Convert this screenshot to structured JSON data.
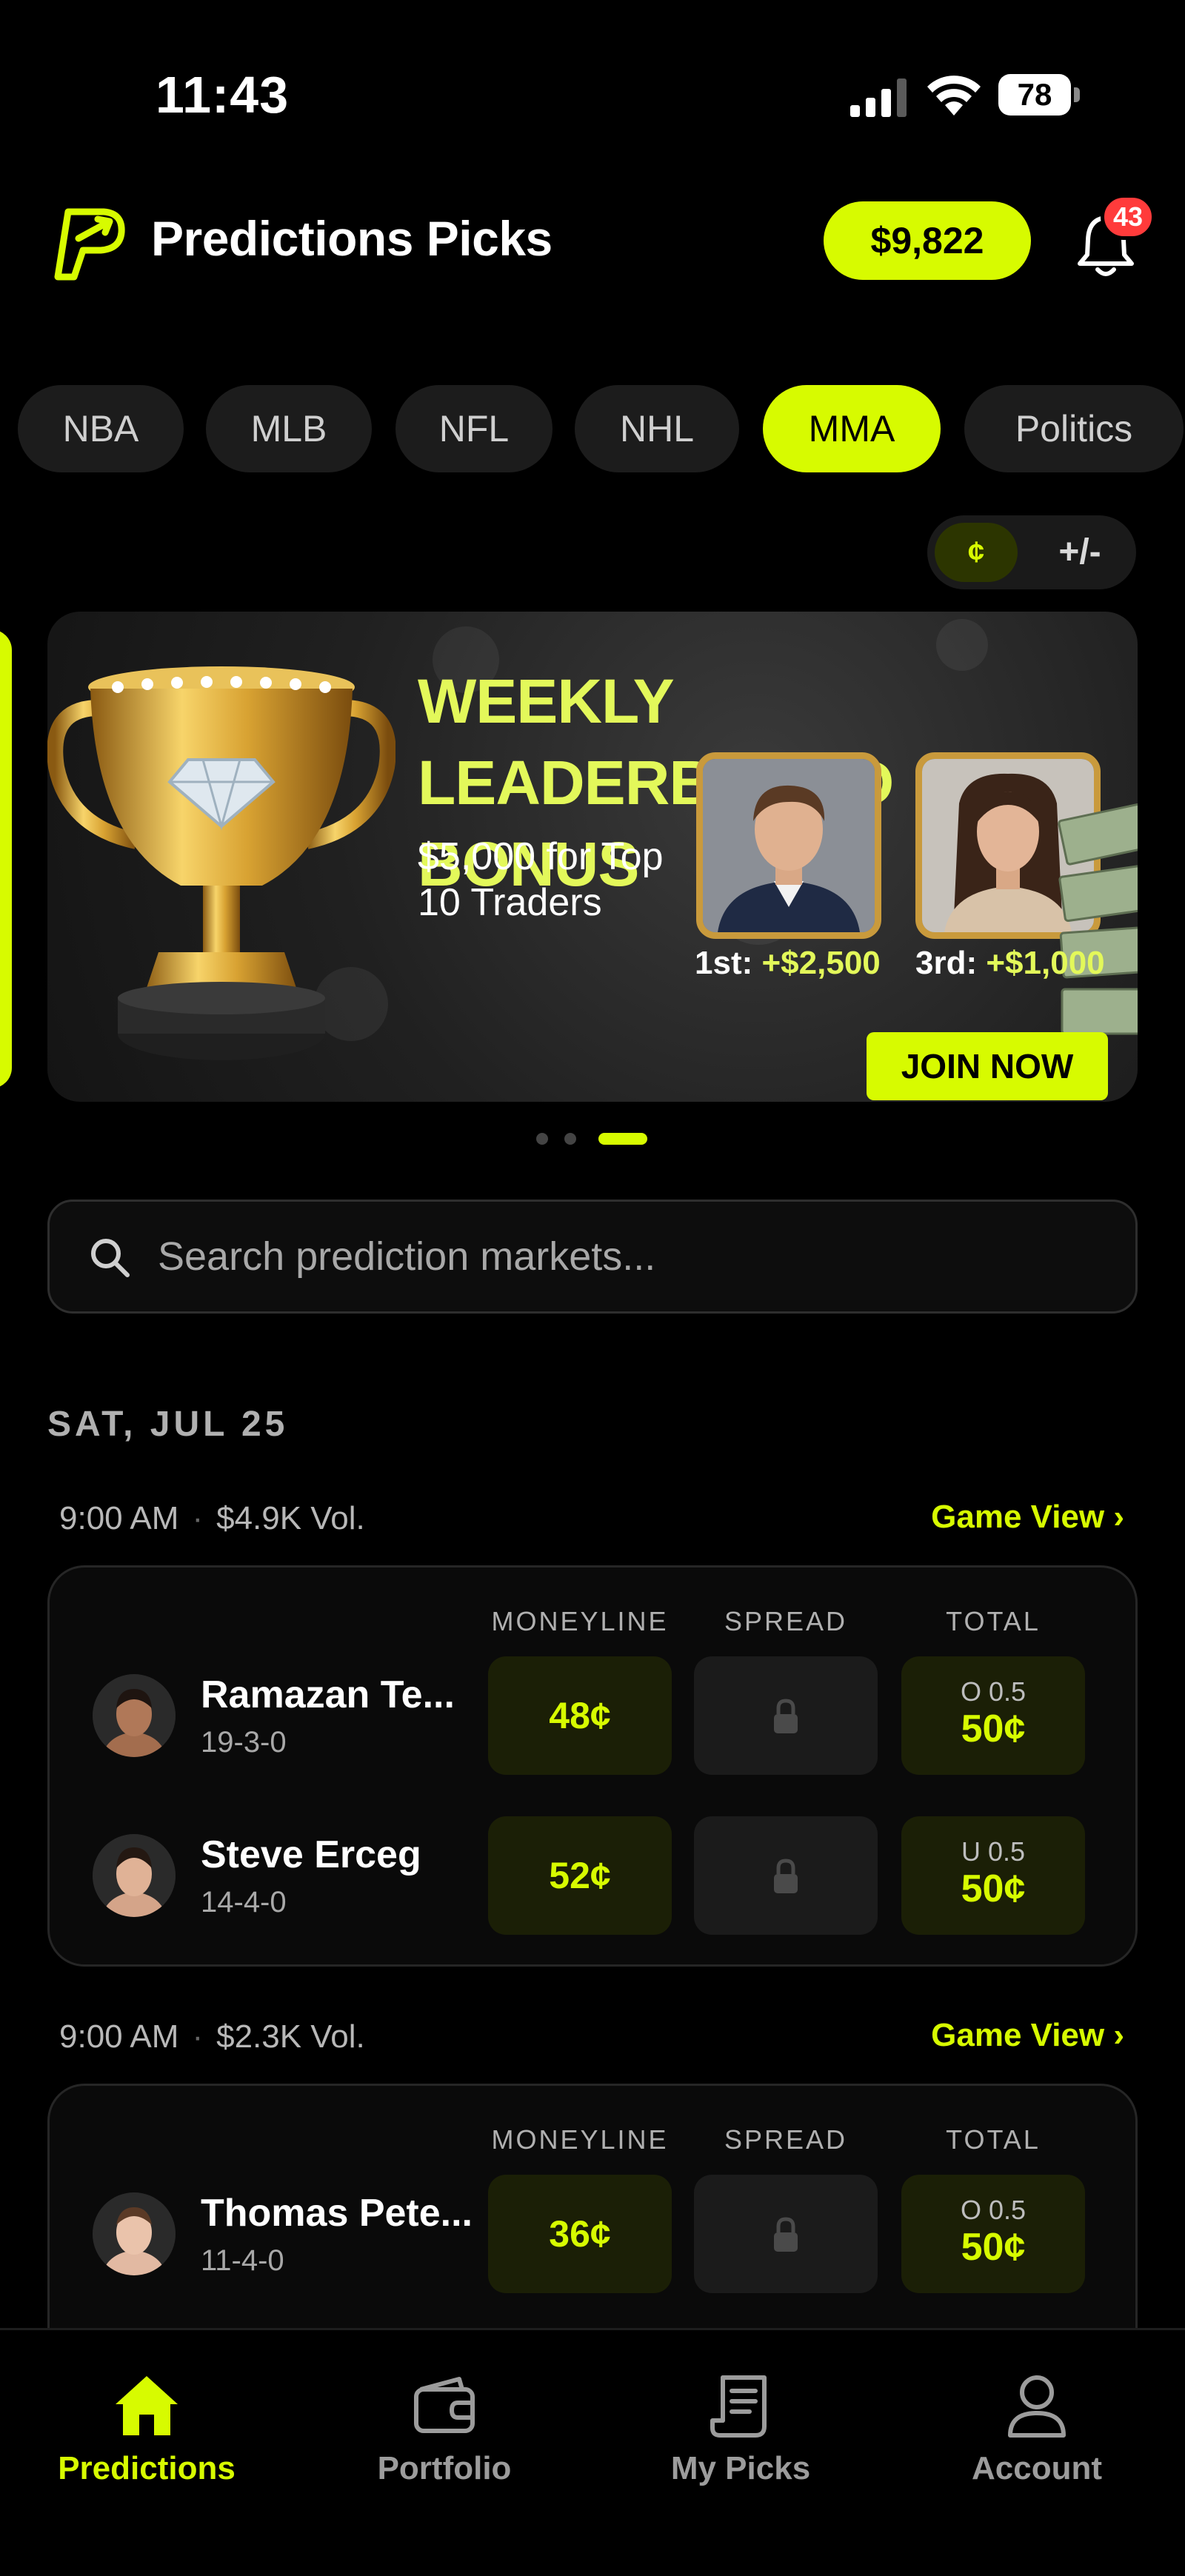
{
  "status_bar": {
    "time": "11:43",
    "battery": "78"
  },
  "header": {
    "title": "Predictions Picks",
    "balance": "$9,822",
    "notifications": "43"
  },
  "tabs": [
    {
      "label": "NBA",
      "active": false
    },
    {
      "label": "MLB",
      "active": false
    },
    {
      "label": "NFL",
      "active": false
    },
    {
      "label": "NHL",
      "active": false
    },
    {
      "label": "MMA",
      "active": true
    },
    {
      "label": "Politics",
      "active": false
    }
  ],
  "toggle": {
    "cents": "¢",
    "plus_minus": "+/-"
  },
  "banner": {
    "title_line1": "WEEKLY LEADERBOARD",
    "title_line2": "BONUS",
    "subtitle": "$5,000 for Top 10 Traders",
    "prize1_rank": "1st:",
    "prize1_amount": "+$2,500",
    "prize2_rank": "3rd:",
    "prize2_amount": "+$1,000",
    "cta": "JOIN NOW"
  },
  "carousel": {
    "count": 3,
    "active_index": 2
  },
  "search": {
    "placeholder": "Search prediction markets..."
  },
  "date_heading": "SAT, JUL 25",
  "columns": {
    "moneyline": "MONEYLINE",
    "spread": "SPREAD",
    "total": "TOTAL"
  },
  "games": [
    {
      "time": "9:00 AM",
      "volume": "$4.9K Vol.",
      "game_view": "Game View ›",
      "fighters": [
        {
          "name": "Ramazan Te...",
          "record": "19-3-0",
          "moneyline": "48¢",
          "total_line": "O 0.5",
          "total_price": "50¢"
        },
        {
          "name": "Steve Erceg",
          "record": "14-4-0",
          "moneyline": "52¢",
          "total_line": "U 0.5",
          "total_price": "50¢"
        }
      ]
    },
    {
      "time": "9:00 AM",
      "volume": "$2.3K Vol.",
      "game_view": "Game View ›",
      "fighters": [
        {
          "name": "Thomas Pete...",
          "record": "11-4-0",
          "moneyline": "36¢",
          "total_line": "O 0.5",
          "total_price": "50¢"
        }
      ]
    }
  ],
  "bottom_nav": [
    {
      "label": "Predictions",
      "icon": "home-icon",
      "active": true
    },
    {
      "label": "Portfolio",
      "icon": "wallet-icon",
      "active": false
    },
    {
      "label": "My Picks",
      "icon": "receipt-icon",
      "active": false
    },
    {
      "label": "Account",
      "icon": "person-icon",
      "active": false
    }
  ],
  "colors": {
    "accent": "#d7fb00",
    "background": "#000000",
    "badge": "#ff3b3b"
  }
}
